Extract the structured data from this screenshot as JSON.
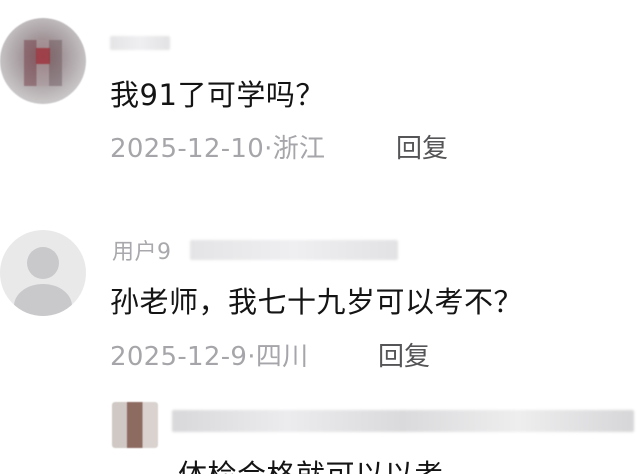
{
  "comments": [
    {
      "text": "我91了可学吗？",
      "date": "2025-12-10",
      "location": "浙江",
      "reply_label": "回复"
    },
    {
      "user_prefix": "用户9",
      "text": "孙老师，我七十九岁可以考不？",
      "date": "2025-12-9",
      "location": "四川",
      "reply_label": "回复"
    },
    {
      "text": "体检合格就可以以考"
    }
  ],
  "separator": "·"
}
